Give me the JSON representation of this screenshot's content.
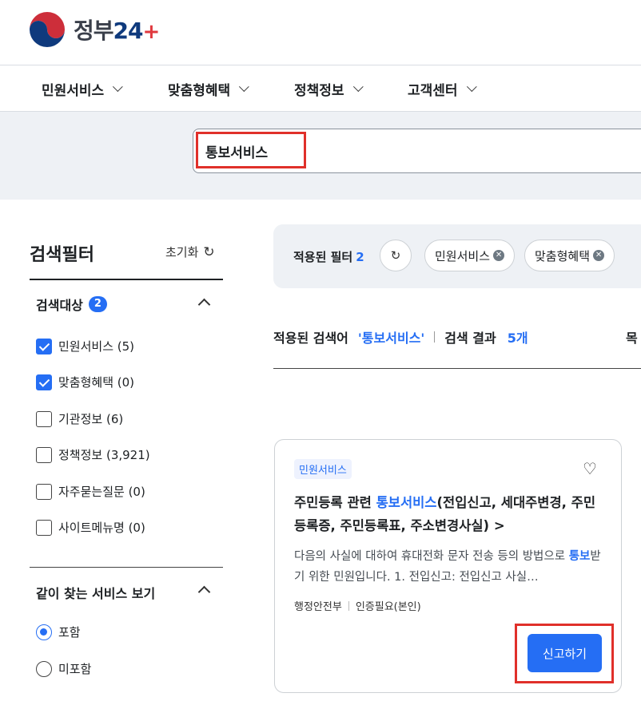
{
  "brand": {
    "name": "정부",
    "suffix": "24"
  },
  "gnb": [
    "민원서비스",
    "맞춤형혜택",
    "정책정보",
    "고객센터"
  ],
  "search": {
    "value": "통보서비스"
  },
  "filter": {
    "title": "검색필터",
    "reset_label": "초기화",
    "target_section": {
      "title": "검색대상",
      "badge": "2"
    },
    "targets": [
      {
        "label": "민원서비스 (5)",
        "checked": true
      },
      {
        "label": "맞춤형혜택 (0)",
        "checked": true
      },
      {
        "label": "기관정보 (6)",
        "checked": false
      },
      {
        "label": "정책정보 (3,921)",
        "checked": false
      },
      {
        "label": "자주묻는질문 (0)",
        "checked": false
      },
      {
        "label": "사이트메뉴명 (0)",
        "checked": false
      }
    ],
    "together_section": {
      "title": "같이 찾는 서비스 보기"
    },
    "together_options": [
      {
        "label": "포함",
        "selected": true
      },
      {
        "label": "미포함",
        "selected": false
      }
    ]
  },
  "applied": {
    "label": "적용된 필터",
    "count": "2",
    "chips": [
      "민원서비스",
      "맞춤형혜택"
    ]
  },
  "results": {
    "keyword_label": "적용된 검색어",
    "keyword": "'통보서비스'",
    "count_label": "검색 결과",
    "count": "5개",
    "list_label_cut": "목"
  },
  "card": {
    "tag": "민원서비스",
    "title_prefix": "주민등록 관련 ",
    "title_keyword": "통보서비스",
    "title_rest": "(전입신고, 세대주변경, 주민등록증, 주민등록표, 주소변경사실) >",
    "desc_prefix": "다음의 사실에 대하여 휴대전화 문자 전송 등의 방법으로 ",
    "desc_keyword": "통보",
    "desc_rest": "받기 위한 민원입니다. 1. 전입신고: 전입신고 사실…",
    "org": "행정안전부",
    "auth": "인증필요(본인)",
    "apply_label": "신고하기"
  },
  "colors": {
    "accent": "#256ef4",
    "highlight_box": "#e0302a",
    "band": "#eef1f5"
  }
}
